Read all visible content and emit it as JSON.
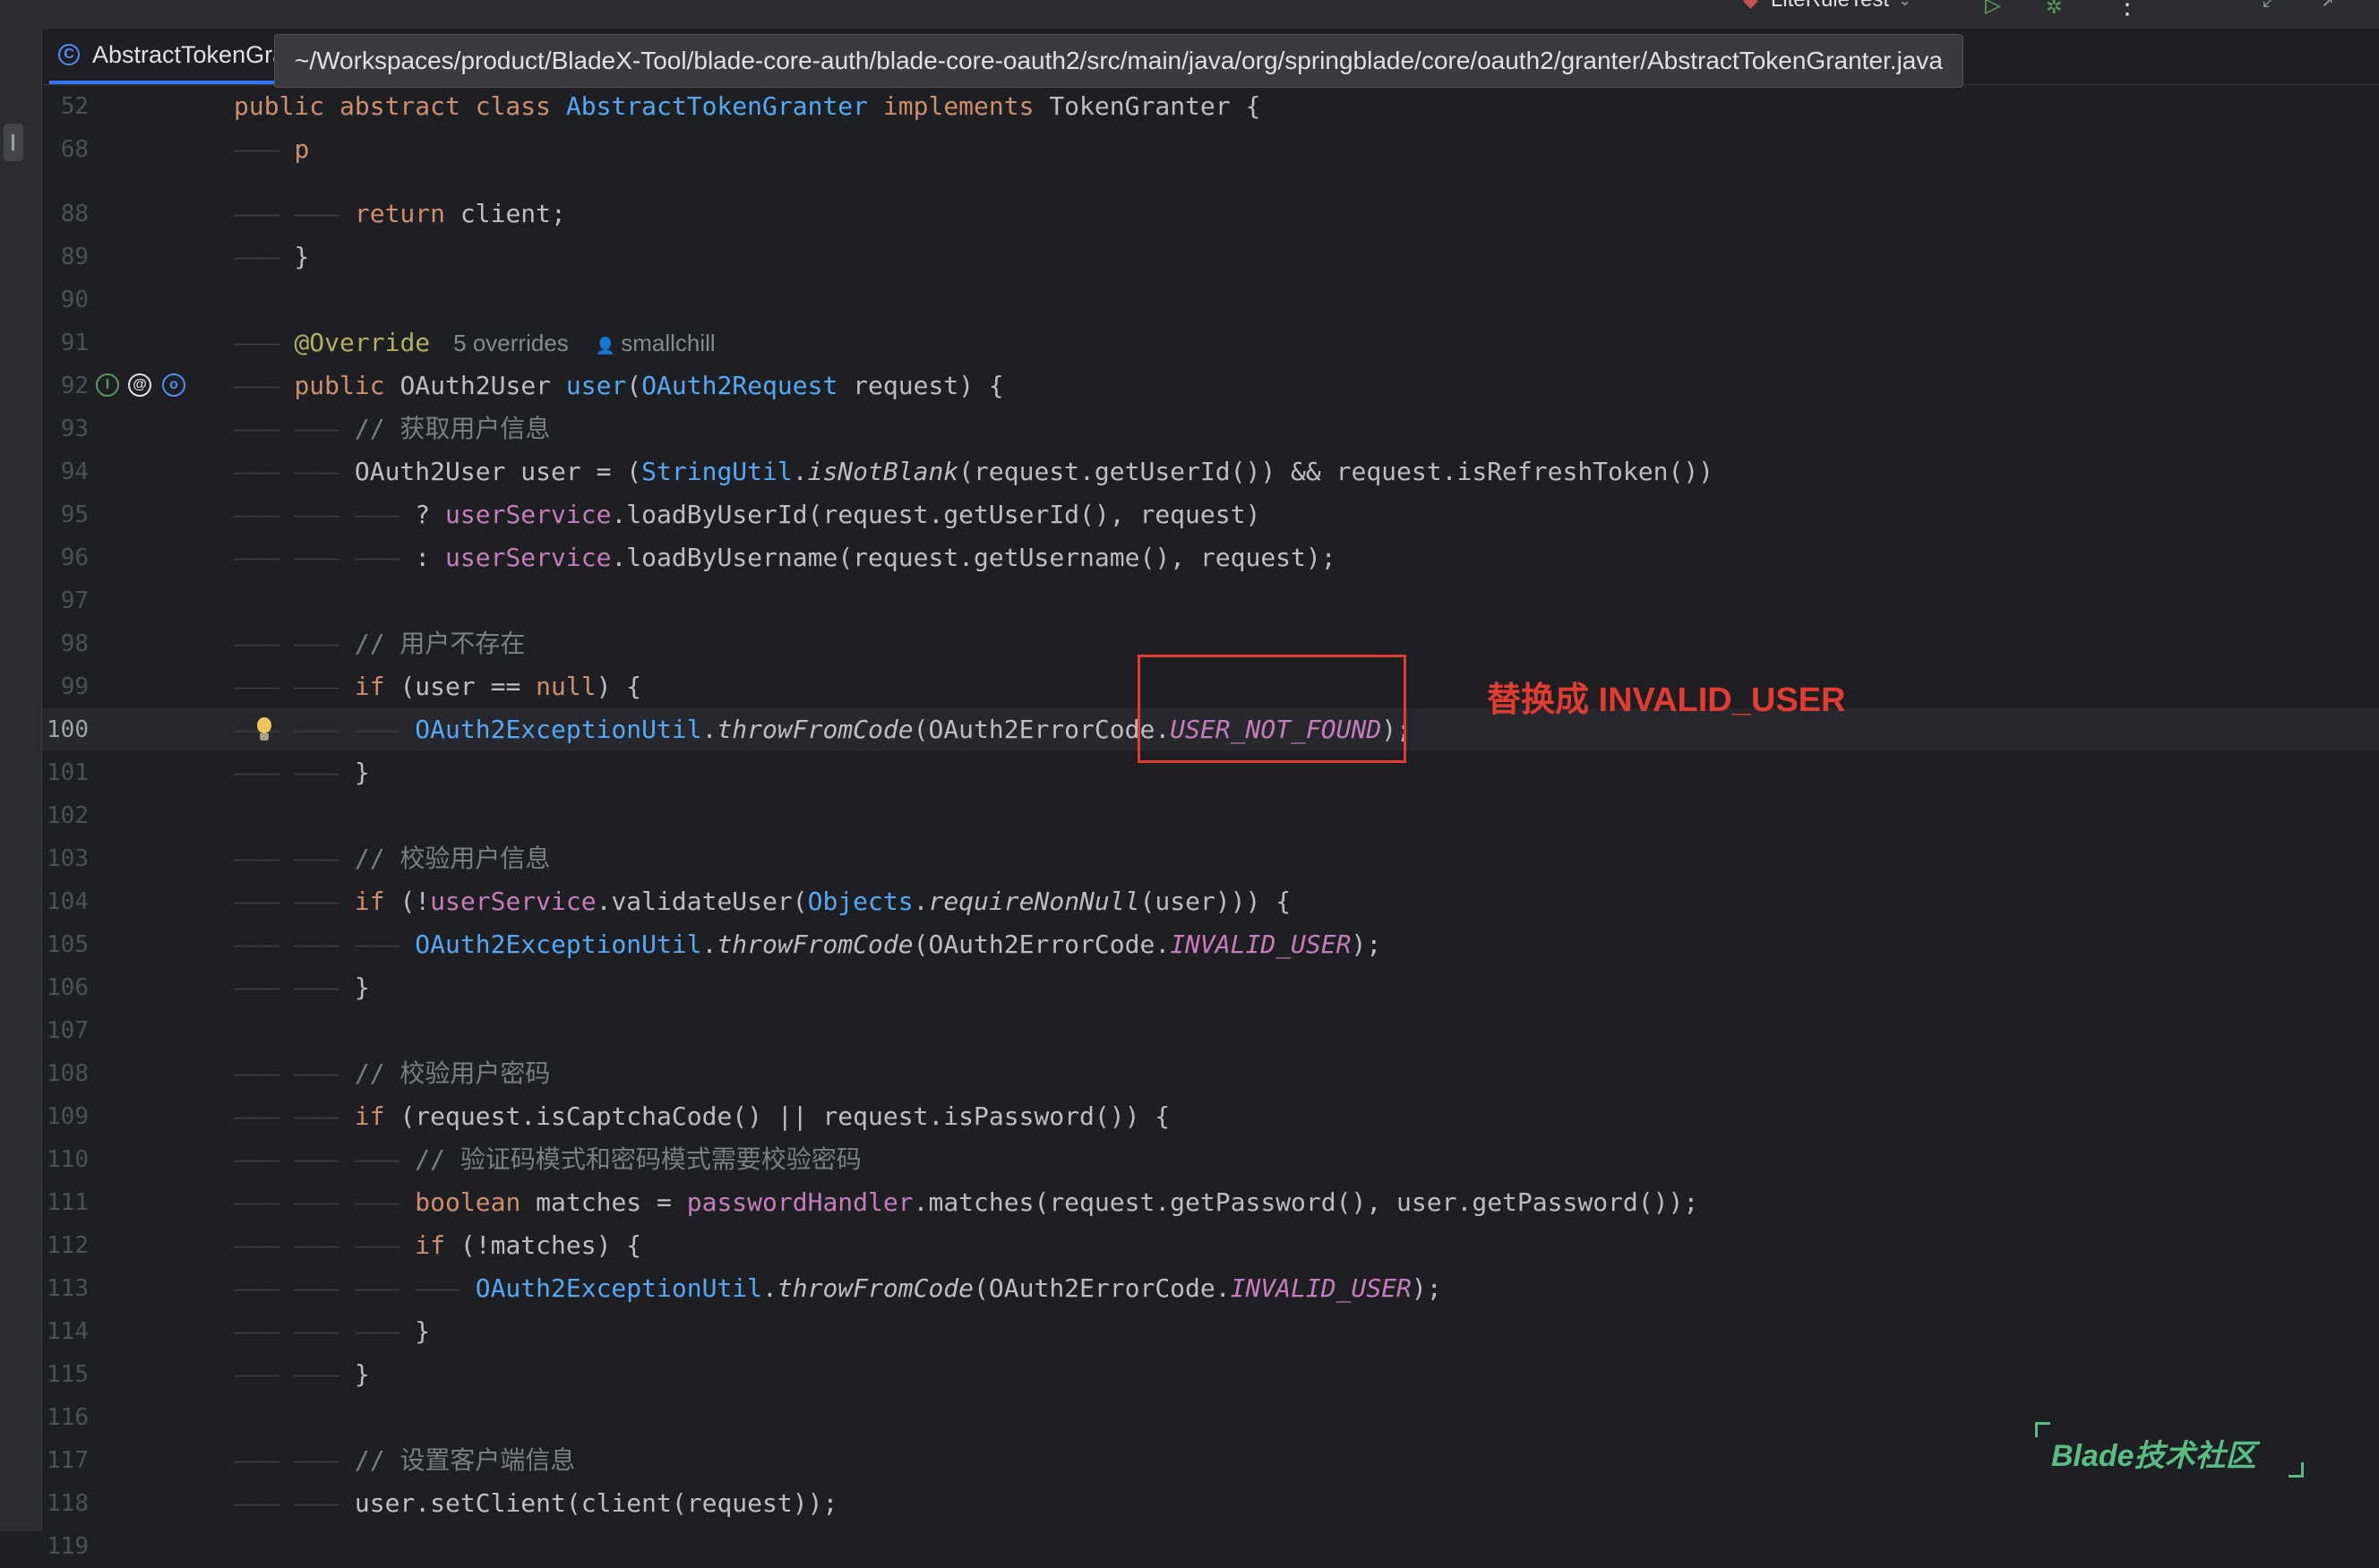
{
  "toolbar": {
    "run_config": "LiteRuleTest",
    "run_icon": "play-icon",
    "debug_icon": "bug-icon",
    "more_icon": "more-vertical-icon"
  },
  "tab": {
    "icon": "java-class-icon",
    "icon_glyph": "C",
    "label": "AbstractTokenGranter.java",
    "close": "×"
  },
  "tooltip": {
    "path": "~/Workspaces/product/BladeX-Tool/blade-core-auth/blade-core-oauth2/src/main/java/org/springblade/core/oauth2/granter/AbstractTokenGranter.java"
  },
  "editor": {
    "current_line": "100",
    "gutter_icons": [
      "override-up-icon",
      "annotation-icon",
      "implemented-icon"
    ],
    "inlay": {
      "overrides": "5 overrides",
      "author": "smallchill"
    }
  },
  "annotation": {
    "text": "替换成 INVALID_USER",
    "color": "#e03c31"
  },
  "watermark": {
    "text": "Blade技术社区"
  },
  "colors": {
    "background": "#1e1f22",
    "keyword": "#cf8e6d",
    "method": "#56a8f5",
    "field": "#c77dbb",
    "comment": "#7a7e85",
    "accent": "#3574f0"
  },
  "lines": [
    {
      "num": "52",
      "tokens": [
        [
          "k",
          "public abstract class "
        ],
        [
          "cl",
          "AbstractTokenGranter"
        ],
        [
          "k",
          " implements "
        ],
        [
          "",
          "TokenGranter {"
        ]
      ]
    },
    {
      "num": "68",
      "tokens": [
        [
          "ind",
          "——— "
        ],
        [
          "k",
          "p"
        ]
      ]
    },
    {
      "num": "88",
      "tokens": [
        [
          "ind",
          "——— ——— "
        ],
        [
          "k",
          "return "
        ],
        [
          "",
          "client;"
        ]
      ]
    },
    {
      "num": "89",
      "tokens": [
        [
          "ind",
          "——— "
        ],
        [
          "",
          "}"
        ]
      ]
    },
    {
      "num": "90",
      "tokens": []
    },
    {
      "num": "91",
      "tokens": [
        [
          "ind",
          "——— "
        ],
        [
          "an",
          "@Override"
        ]
      ]
    },
    {
      "num": "92",
      "tokens": [
        [
          "ind",
          "——— "
        ],
        [
          "k",
          "public "
        ],
        [
          "",
          "OAuth2User "
        ],
        [
          "fn",
          "user"
        ],
        [
          "",
          "("
        ],
        [
          "cl",
          "OAuth2Request"
        ],
        [
          "",
          " request) {"
        ]
      ]
    },
    {
      "num": "93",
      "tokens": [
        [
          "ind",
          "——— ——— "
        ],
        [
          "cm",
          "// 获取用户信息"
        ]
      ]
    },
    {
      "num": "94",
      "tokens": [
        [
          "ind",
          "——— ——— "
        ],
        [
          "",
          "OAuth2User user = ("
        ],
        [
          "cl",
          "StringUtil"
        ],
        [
          "",
          "."
        ],
        [
          "it",
          "isNotBlank"
        ],
        [
          "",
          "(request.getUserId()) && request.isRefreshToken())"
        ]
      ]
    },
    {
      "num": "95",
      "tokens": [
        [
          "ind",
          "——— ——— ——— "
        ],
        [
          "",
          "? "
        ],
        [
          "f",
          "userService"
        ],
        [
          "",
          ".loadByUserId(request.getUserId(), request)"
        ]
      ]
    },
    {
      "num": "96",
      "tokens": [
        [
          "ind",
          "——— ——— ——— "
        ],
        [
          "",
          ": "
        ],
        [
          "f",
          "userService"
        ],
        [
          "",
          ".loadByUsername(request.getUsername(), request);"
        ]
      ]
    },
    {
      "num": "97",
      "tokens": []
    },
    {
      "num": "98",
      "tokens": [
        [
          "ind",
          "——— ——— "
        ],
        [
          "cm",
          "// 用户不存在"
        ]
      ]
    },
    {
      "num": "99",
      "tokens": [
        [
          "ind",
          "——— ——— "
        ],
        [
          "k",
          "if "
        ],
        [
          "",
          "(user == "
        ],
        [
          "k",
          "null"
        ],
        [
          "",
          ") {"
        ]
      ]
    },
    {
      "num": "100",
      "tokens": [
        [
          "ind",
          "——— ——— ——— "
        ],
        [
          "cl",
          "OAuth2ExceptionUtil"
        ],
        [
          "",
          "."
        ],
        [
          "it",
          "throwFromCode"
        ],
        [
          "",
          "(OAuth2ErrorCode."
        ],
        [
          "st",
          "USER_NOT_FOUND"
        ],
        [
          "",
          ");"
        ]
      ]
    },
    {
      "num": "101",
      "tokens": [
        [
          "ind",
          "——— ——— "
        ],
        [
          "",
          "}"
        ]
      ]
    },
    {
      "num": "102",
      "tokens": []
    },
    {
      "num": "103",
      "tokens": [
        [
          "ind",
          "——— ——— "
        ],
        [
          "cm",
          "// 校验用户信息"
        ]
      ]
    },
    {
      "num": "104",
      "tokens": [
        [
          "ind",
          "——— ——— "
        ],
        [
          "k",
          "if "
        ],
        [
          "",
          "(!"
        ],
        [
          "f",
          "userService"
        ],
        [
          "",
          ".validateUser("
        ],
        [
          "cl",
          "Objects"
        ],
        [
          "",
          "."
        ],
        [
          "it",
          "requireNonNull"
        ],
        [
          "",
          "(user))) {"
        ]
      ]
    },
    {
      "num": "105",
      "tokens": [
        [
          "ind",
          "——— ——— ——— "
        ],
        [
          "cl",
          "OAuth2ExceptionUtil"
        ],
        [
          "",
          "."
        ],
        [
          "it",
          "throwFromCode"
        ],
        [
          "",
          "(OAuth2ErrorCode."
        ],
        [
          "st",
          "INVALID_USER"
        ],
        [
          "",
          ");"
        ]
      ]
    },
    {
      "num": "106",
      "tokens": [
        [
          "ind",
          "——— ——— "
        ],
        [
          "",
          "}"
        ]
      ]
    },
    {
      "num": "107",
      "tokens": []
    },
    {
      "num": "108",
      "tokens": [
        [
          "ind",
          "——— ——— "
        ],
        [
          "cm",
          "// 校验用户密码"
        ]
      ]
    },
    {
      "num": "109",
      "tokens": [
        [
          "ind",
          "——— ——— "
        ],
        [
          "k",
          "if "
        ],
        [
          "",
          "(request.isCaptchaCode() || request.isPassword()) {"
        ]
      ]
    },
    {
      "num": "110",
      "tokens": [
        [
          "ind",
          "——— ——— ——— "
        ],
        [
          "cm",
          "// 验证码模式和密码模式需要校验密码"
        ]
      ]
    },
    {
      "num": "111",
      "tokens": [
        [
          "ind",
          "——— ——— ——— "
        ],
        [
          "k",
          "boolean "
        ],
        [
          "",
          "matches = "
        ],
        [
          "f",
          "passwordHandler"
        ],
        [
          "",
          ".matches(request.getPassword(), user.getPassword());"
        ]
      ]
    },
    {
      "num": "112",
      "tokens": [
        [
          "ind",
          "——— ——— ——— "
        ],
        [
          "k",
          "if "
        ],
        [
          "",
          "(!matches) {"
        ]
      ]
    },
    {
      "num": "113",
      "tokens": [
        [
          "ind",
          "——— ——— ——— ——— "
        ],
        [
          "cl",
          "OAuth2ExceptionUtil"
        ],
        [
          "",
          "."
        ],
        [
          "it",
          "throwFromCode"
        ],
        [
          "",
          "(OAuth2ErrorCode."
        ],
        [
          "st",
          "INVALID_USER"
        ],
        [
          "",
          ");"
        ]
      ]
    },
    {
      "num": "114",
      "tokens": [
        [
          "ind",
          "——— ——— ——— "
        ],
        [
          "",
          "}"
        ]
      ]
    },
    {
      "num": "115",
      "tokens": [
        [
          "ind",
          "——— ——— "
        ],
        [
          "",
          "}"
        ]
      ]
    },
    {
      "num": "116",
      "tokens": []
    },
    {
      "num": "117",
      "tokens": [
        [
          "ind",
          "——— ——— "
        ],
        [
          "cm",
          "// 设置客户端信息"
        ]
      ]
    },
    {
      "num": "118",
      "tokens": [
        [
          "ind",
          "——— ——— "
        ],
        [
          "",
          "user.setClient(client(request));"
        ]
      ]
    },
    {
      "num": "119",
      "tokens": []
    }
  ]
}
